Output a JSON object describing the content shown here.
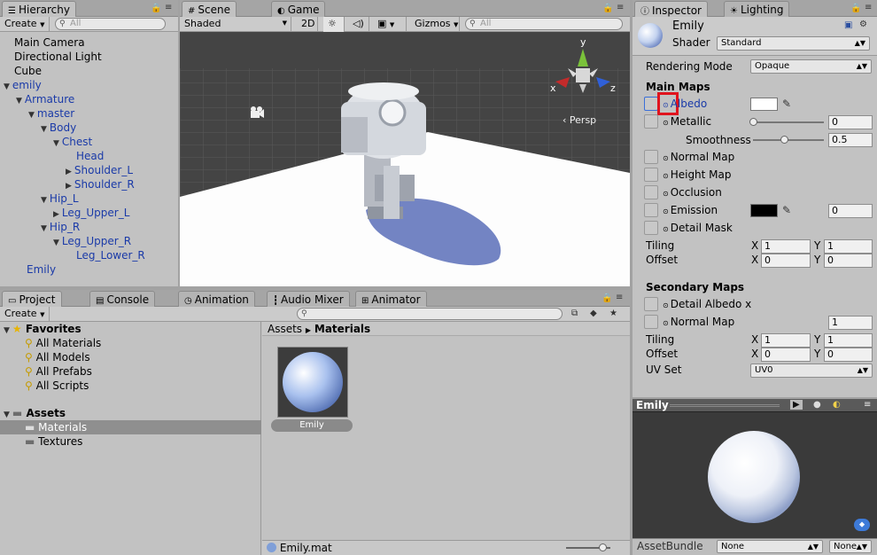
{
  "hierarchy": {
    "tab": "Hierarchy",
    "create": "Create",
    "search_placeholder": "All",
    "items": [
      {
        "label": "Main Camera",
        "indent": 0,
        "arrow": "",
        "blue": false
      },
      {
        "label": "Directional Light",
        "indent": 0,
        "arrow": "",
        "blue": false
      },
      {
        "label": "Cube",
        "indent": 0,
        "arrow": "",
        "blue": false
      },
      {
        "label": "emily",
        "indent": 0,
        "arrow": "▼",
        "blue": true
      },
      {
        "label": "Armature",
        "indent": 1,
        "arrow": "▼",
        "blue": true
      },
      {
        "label": "master",
        "indent": 2,
        "arrow": "▼",
        "blue": true
      },
      {
        "label": "Body",
        "indent": 3,
        "arrow": "▼",
        "blue": true
      },
      {
        "label": "Chest",
        "indent": 4,
        "arrow": "▼",
        "blue": true
      },
      {
        "label": "Head",
        "indent": 5,
        "arrow": "",
        "blue": true
      },
      {
        "label": "Shoulder_L",
        "indent": 5,
        "arrow": "▶",
        "blue": true
      },
      {
        "label": "Shoulder_R",
        "indent": 5,
        "arrow": "▶",
        "blue": true
      },
      {
        "label": "Hip_L",
        "indent": 3,
        "arrow": "▼",
        "blue": true
      },
      {
        "label": "Leg_Upper_L",
        "indent": 4,
        "arrow": "▶",
        "blue": true
      },
      {
        "label": "Hip_R",
        "indent": 3,
        "arrow": "▼",
        "blue": true
      },
      {
        "label": "Leg_Upper_R",
        "indent": 4,
        "arrow": "▼",
        "blue": true
      },
      {
        "label": "Leg_Lower_R",
        "indent": 5,
        "arrow": "",
        "blue": true
      },
      {
        "label": "Emily",
        "indent": 1,
        "arrow": "",
        "blue": true
      }
    ]
  },
  "scene": {
    "tab_scene": "Scene",
    "tab_game": "Game",
    "shading": "Shaded",
    "mode_2d": "2D",
    "gizmos": "Gizmos",
    "search_placeholder": "All",
    "persp": "Persp",
    "axis_y": "y",
    "axis_x": "x",
    "axis_z": "z"
  },
  "project": {
    "tabs": [
      "Project",
      "Console",
      "Animation",
      "Audio Mixer",
      "Animator"
    ],
    "create": "Create",
    "favorites_label": "Favorites",
    "favorites": [
      "All Materials",
      "All Models",
      "All Prefabs",
      "All Scripts"
    ],
    "assets_label": "Assets",
    "assets": [
      "Materials",
      "Textures"
    ],
    "breadcrumb_root": "Assets",
    "breadcrumb_current": "Materials",
    "asset_name": "Emily",
    "footer_file": "Emily.mat"
  },
  "inspector": {
    "tab": "Inspector",
    "tab_lighting": "Lighting",
    "material_name": "Emily",
    "shader_label": "Shader",
    "shader_value": "Standard",
    "rendering_mode_label": "Rendering Mode",
    "rendering_mode_value": "Opaque",
    "main_maps": "Main Maps",
    "albedo": "Albedo",
    "metallic": "Metallic",
    "metallic_value": "0",
    "metallic_level": 0,
    "smoothness": "Smoothness",
    "smoothness_value": "0.5",
    "smoothness_level": 0.5,
    "normal_map": "Normal Map",
    "height_map": "Height Map",
    "occlusion": "Occlusion",
    "emission": "Emission",
    "emission_value": "0",
    "detail_mask": "Detail Mask",
    "tiling": "Tiling",
    "offset": "Offset",
    "x": "X",
    "y": "Y",
    "tiling_x": "1",
    "tiling_y": "1",
    "offset_x": "0",
    "offset_y": "0",
    "secondary_maps": "Secondary Maps",
    "detail_albedo": "Detail Albedo x",
    "normal_map2": "Normal Map",
    "normal_map2_value": "1",
    "tiling2_x": "1",
    "tiling2_y": "1",
    "offset2_x": "0",
    "offset2_y": "0",
    "uv_set_label": "UV Set",
    "uv_set_value": "UV0",
    "preview_title": "Emily",
    "assetbundle_label": "AssetBundle",
    "assetbundle_value": "None",
    "assetbundle_variant": "None",
    "colors": {
      "albedo": "#ffffff",
      "emission": "#000000",
      "highlight": "#e0141e"
    }
  }
}
